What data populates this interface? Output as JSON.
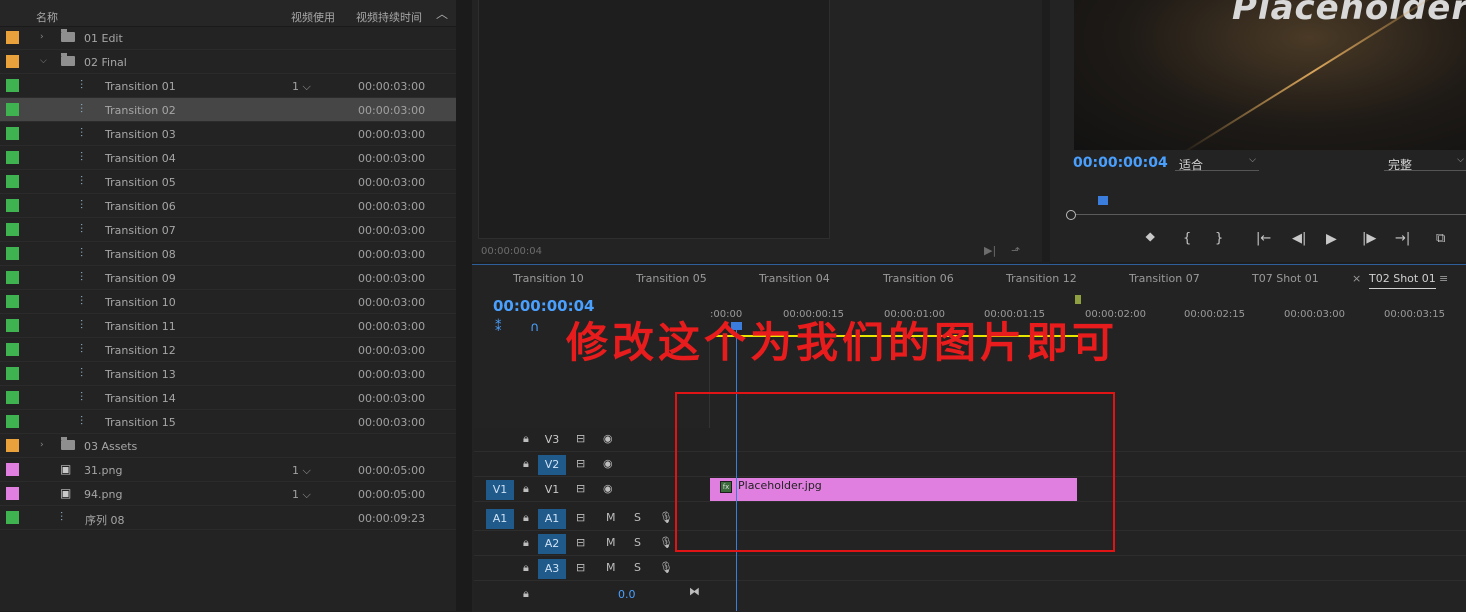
{
  "project": {
    "columns": {
      "name": "名称",
      "video_usage": "视频使用",
      "duration": "视频持续时间"
    },
    "rows": [
      {
        "type": "folder",
        "label_color": "#e9a13b",
        "expanded": false,
        "name": "01 Edit",
        "usage": "",
        "duration": ""
      },
      {
        "type": "folder",
        "label_color": "#e9a13b",
        "expanded": true,
        "name": "02 Final",
        "usage": "",
        "duration": ""
      },
      {
        "type": "sequence",
        "label_color": "#3fb34f",
        "name": "Transition 01",
        "usage": "1",
        "duration": "00:00:03:00"
      },
      {
        "type": "sequence",
        "label_color": "#3fb34f",
        "name": "Transition 02",
        "usage": "",
        "duration": "00:00:03:00",
        "selected": true
      },
      {
        "type": "sequence",
        "label_color": "#3fb34f",
        "name": "Transition 03",
        "usage": "",
        "duration": "00:00:03:00"
      },
      {
        "type": "sequence",
        "label_color": "#3fb34f",
        "name": "Transition 04",
        "usage": "",
        "duration": "00:00:03:00"
      },
      {
        "type": "sequence",
        "label_color": "#3fb34f",
        "name": "Transition 05",
        "usage": "",
        "duration": "00:00:03:00"
      },
      {
        "type": "sequence",
        "label_color": "#3fb34f",
        "name": "Transition 06",
        "usage": "",
        "duration": "00:00:03:00"
      },
      {
        "type": "sequence",
        "label_color": "#3fb34f",
        "name": "Transition 07",
        "usage": "",
        "duration": "00:00:03:00"
      },
      {
        "type": "sequence",
        "label_color": "#3fb34f",
        "name": "Transition 08",
        "usage": "",
        "duration": "00:00:03:00"
      },
      {
        "type": "sequence",
        "label_color": "#3fb34f",
        "name": "Transition 09",
        "usage": "",
        "duration": "00:00:03:00"
      },
      {
        "type": "sequence",
        "label_color": "#3fb34f",
        "name": "Transition 10",
        "usage": "",
        "duration": "00:00:03:00"
      },
      {
        "type": "sequence",
        "label_color": "#3fb34f",
        "name": "Transition 11",
        "usage": "",
        "duration": "00:00:03:00"
      },
      {
        "type": "sequence",
        "label_color": "#3fb34f",
        "name": "Transition 12",
        "usage": "",
        "duration": "00:00:03:00"
      },
      {
        "type": "sequence",
        "label_color": "#3fb34f",
        "name": "Transition 13",
        "usage": "",
        "duration": "00:00:03:00"
      },
      {
        "type": "sequence",
        "label_color": "#3fb34f",
        "name": "Transition 14",
        "usage": "",
        "duration": "00:00:03:00"
      },
      {
        "type": "sequence",
        "label_color": "#3fb34f",
        "name": "Transition 15",
        "usage": "",
        "duration": "00:00:03:00"
      },
      {
        "type": "folder",
        "label_color": "#e9a13b",
        "expanded": false,
        "name": "03 Assets",
        "usage": "",
        "duration": ""
      },
      {
        "type": "image",
        "label_color": "#e07fe0",
        "name": "31.png",
        "usage": "1",
        "duration": "00:00:05:00"
      },
      {
        "type": "image",
        "label_color": "#e07fe0",
        "name": "94.png",
        "usage": "1",
        "duration": "00:00:05:00"
      },
      {
        "type": "sequence",
        "label_color": "#3fb34f",
        "name": "序列 08",
        "usage": "",
        "duration": "00:00:09:23"
      }
    ]
  },
  "source": {
    "timecode": "00:00:00:04"
  },
  "program": {
    "image_title": "Placeholder",
    "timecode": "00:00:00:04",
    "fit_select": "适合",
    "quality_select": "完整"
  },
  "timeline": {
    "tabs": [
      "Transition 10",
      "Transition 05",
      "Transition 04",
      "Transition 06",
      "Transition 12",
      "Transition 07",
      "T07 Shot 01",
      "T02 Shot 01"
    ],
    "active_tab": "T02 Shot 01",
    "close_glyph": "×",
    "timecode": "00:00:00:04",
    "ruler": [
      ":00:00",
      "00:00:00:15",
      "00:00:01:00",
      "00:00:01:15",
      "00:00:02:00",
      "00:00:02:15",
      "00:00:03:00",
      "00:00:03:15"
    ],
    "video_tracks": [
      {
        "name": "V3",
        "source": ""
      },
      {
        "name": "V2",
        "source": ""
      },
      {
        "name": "V1",
        "source": "V1"
      }
    ],
    "audio_tracks": [
      {
        "name": "A1",
        "source": "A1"
      },
      {
        "name": "A2",
        "source": ""
      },
      {
        "name": "A3",
        "source": ""
      }
    ],
    "mute_label": "M",
    "solo_label": "S",
    "master_value": "0.0",
    "clip": {
      "name": "Placeholder.jpg",
      "color": "#e07fe0"
    },
    "annotation": "修改这个为我们的图片即可"
  },
  "colors": {
    "accent": "#4aa0ff",
    "annotation_red": "#e01414",
    "workarea": "#e6e600"
  }
}
